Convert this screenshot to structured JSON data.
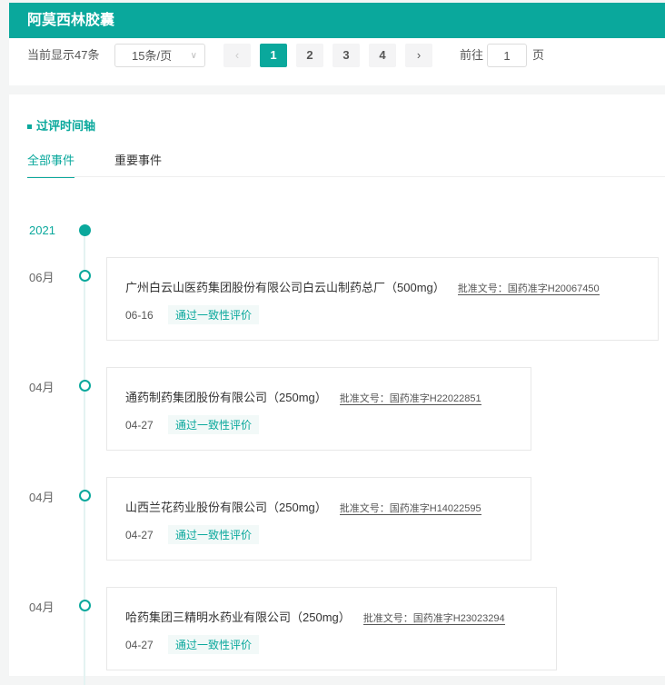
{
  "title": "阿莫西林胶囊",
  "pagination": {
    "total_text": "当前显示47条",
    "page_size": "15条/页",
    "prev": "‹",
    "next": "›",
    "pages": [
      "1",
      "2",
      "3",
      "4"
    ],
    "current": "1",
    "goto_label": "前往",
    "goto_value": "1",
    "page_suffix": "页"
  },
  "section_title": "过评时间轴",
  "tabs": [
    "全部事件",
    "重要事件"
  ],
  "timeline": {
    "year": "2021",
    "events": [
      {
        "month": "06月",
        "company": "广州白云山医药集团股份有限公司白云山制药总厂（500mg）",
        "approval": "批准文号：国药准字H20067450",
        "date": "06-16",
        "tag": "通过一致性评价"
      },
      {
        "month": "04月",
        "company": "通药制药集团股份有限公司（250mg）",
        "approval": "批准文号：国药准字H22022851",
        "date": "04-27",
        "tag": "通过一致性评价"
      },
      {
        "month": "04月",
        "company": "山西兰花药业股份有限公司（250mg）",
        "approval": "批准文号：国药准字H14022595",
        "date": "04-27",
        "tag": "通过一致性评价"
      },
      {
        "month": "04月",
        "company": "哈药集团三精明水药业有限公司（250mg）",
        "approval": "批准文号：国药准字H23023294",
        "date": "04-27",
        "tag": "通过一致性评价"
      }
    ]
  }
}
